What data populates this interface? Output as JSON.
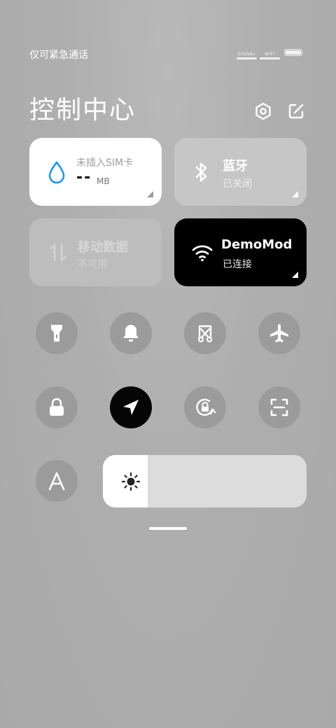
{
  "status_bar": {
    "carrier_text": "仅可紧急通话",
    "signal_label": "SIGNAL",
    "wifi_label": "WIFI"
  },
  "header": {
    "title": "控制中心"
  },
  "tiles": {
    "data_usage": {
      "title": "未插入SIM卡",
      "value": "--",
      "unit": "MB"
    },
    "bluetooth": {
      "title": "蓝牙",
      "status": "已关闭"
    },
    "mobile_data": {
      "title": "移动数据",
      "status": "不可用"
    },
    "wifi": {
      "title": "DemoMod",
      "status": "已连接"
    }
  },
  "brightness": {
    "level": 0.22
  },
  "colors": {
    "accent_blue": "#2196F3",
    "active_tile": "#000000",
    "inactive_circle": "#9b9b9b"
  },
  "icons": {
    "flashlight": "flashlight-icon",
    "bell": "bell-icon",
    "screenshot": "screenshot-icon",
    "airplane": "airplane-icon",
    "lock": "lock-icon",
    "location": "location-icon",
    "rotation": "rotation-lock-icon",
    "scan": "scan-icon",
    "font": "font-icon",
    "brightness": "sun-icon"
  }
}
